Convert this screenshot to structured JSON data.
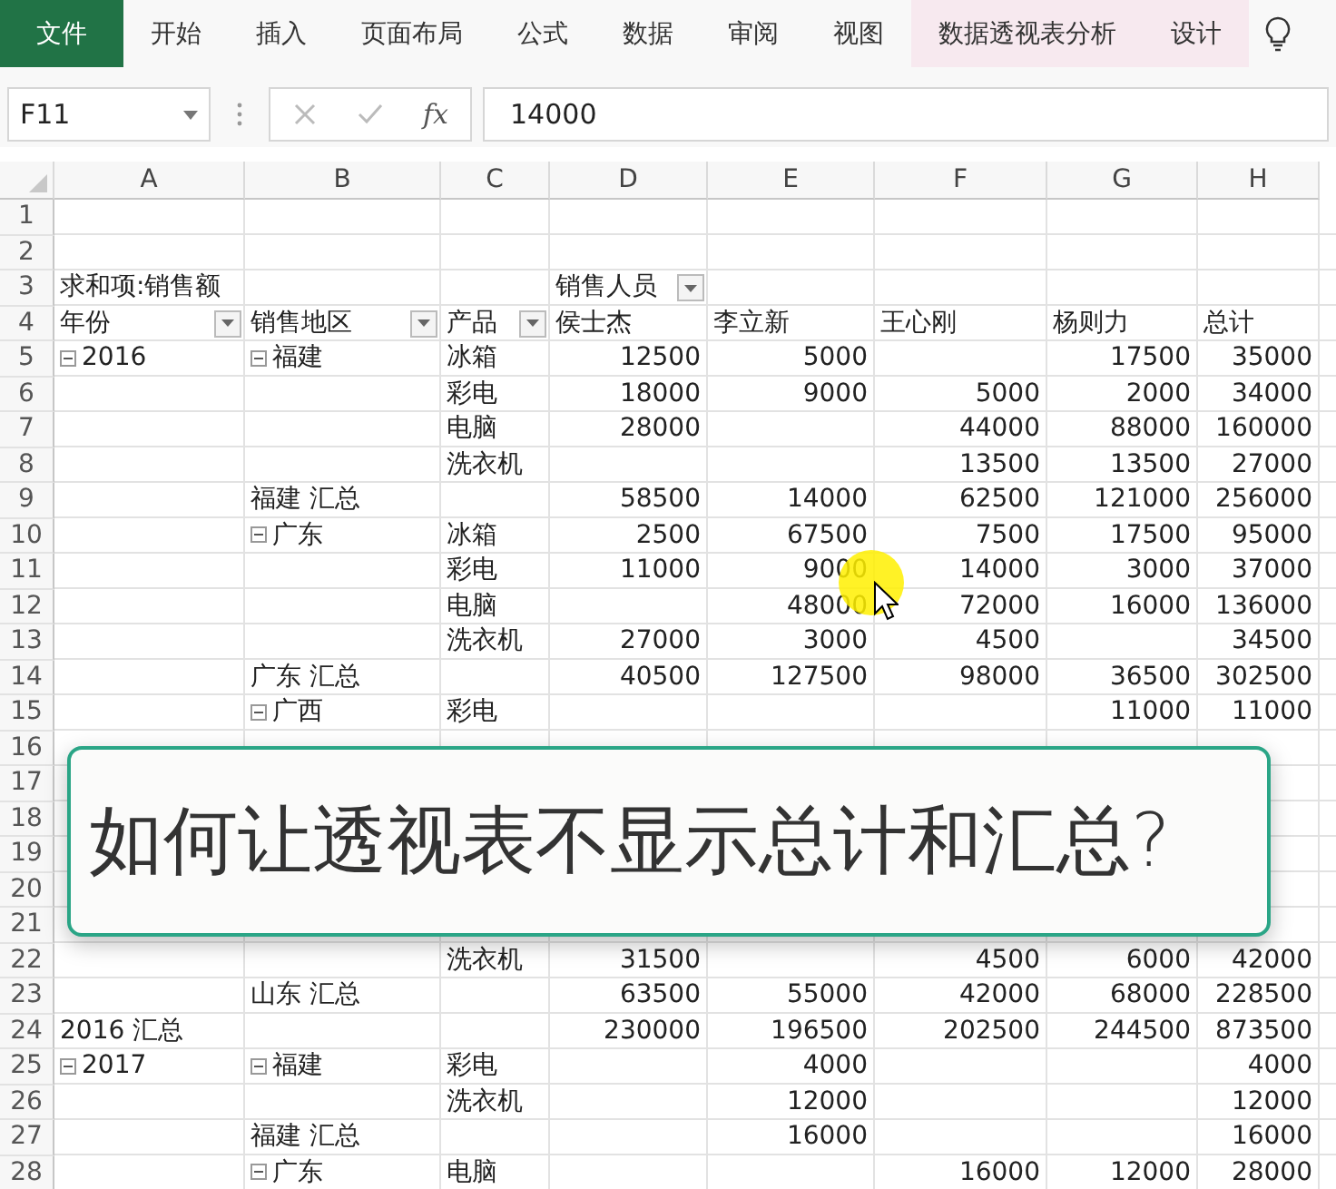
{
  "ribbon": {
    "tabs": [
      {
        "label": "文件",
        "kind": "file"
      },
      {
        "label": "开始",
        "kind": "normal"
      },
      {
        "label": "插入",
        "kind": "normal"
      },
      {
        "label": "页面布局",
        "kind": "normal"
      },
      {
        "label": "公式",
        "kind": "normal"
      },
      {
        "label": "数据",
        "kind": "normal"
      },
      {
        "label": "审阅",
        "kind": "normal"
      },
      {
        "label": "视图",
        "kind": "normal"
      },
      {
        "label": "数据透视表分析",
        "kind": "contextual"
      },
      {
        "label": "设计",
        "kind": "contextual"
      }
    ]
  },
  "formula_bar": {
    "name_box": "F11",
    "function_label": "fx",
    "value": "14000"
  },
  "columns": [
    "A",
    "B",
    "C",
    "D",
    "E",
    "F",
    "G",
    "H"
  ],
  "rows": [
    {
      "n": "1"
    },
    {
      "n": "2"
    },
    {
      "n": "3",
      "labels": {
        "A": {
          "text": "求和项:销售额"
        },
        "D": {
          "text": "销售人员",
          "filter": true
        }
      }
    },
    {
      "n": "4",
      "labels": {
        "A": {
          "text": "年份",
          "filter": true
        },
        "B": {
          "text": "销售地区",
          "filter": true
        },
        "C": {
          "text": "产品",
          "filter": true
        },
        "D": {
          "text": "侯士杰"
        },
        "E": {
          "text": "李立新"
        },
        "F": {
          "text": "王心刚"
        },
        "G": {
          "text": "杨则力"
        },
        "H": {
          "text": "总计"
        }
      }
    },
    {
      "n": "5",
      "labels": {
        "A": {
          "text": "2016",
          "expanded": true
        },
        "B": {
          "text": "福建",
          "expanded": true
        },
        "C": {
          "text": "冰箱"
        }
      },
      "values": {
        "D": "12500",
        "E": "5000",
        "G": "17500",
        "H": "35000"
      }
    },
    {
      "n": "6",
      "labels": {
        "C": {
          "text": "彩电"
        }
      },
      "values": {
        "D": "18000",
        "E": "9000",
        "F": "5000",
        "G": "2000",
        "H": "34000"
      }
    },
    {
      "n": "7",
      "labels": {
        "C": {
          "text": "电脑"
        }
      },
      "values": {
        "D": "28000",
        "F": "44000",
        "G": "88000",
        "H": "160000"
      }
    },
    {
      "n": "8",
      "labels": {
        "C": {
          "text": "洗衣机"
        }
      },
      "values": {
        "F": "13500",
        "G": "13500",
        "H": "27000"
      }
    },
    {
      "n": "9",
      "labels": {
        "B": {
          "text": "福建 汇总"
        }
      },
      "values": {
        "D": "58500",
        "E": "14000",
        "F": "62500",
        "G": "121000",
        "H": "256000"
      }
    },
    {
      "n": "10",
      "labels": {
        "B": {
          "text": "广东",
          "expanded": true
        },
        "C": {
          "text": "冰箱"
        }
      },
      "values": {
        "D": "2500",
        "E": "67500",
        "F": "7500",
        "G": "17500",
        "H": "95000"
      }
    },
    {
      "n": "11",
      "labels": {
        "C": {
          "text": "彩电"
        }
      },
      "values": {
        "D": "11000",
        "E": "9000",
        "F": "14000",
        "G": "3000",
        "H": "37000"
      }
    },
    {
      "n": "12",
      "labels": {
        "C": {
          "text": "电脑"
        }
      },
      "values": {
        "E": "48000",
        "F": "72000",
        "G": "16000",
        "H": "136000"
      }
    },
    {
      "n": "13",
      "labels": {
        "C": {
          "text": "洗衣机"
        }
      },
      "values": {
        "D": "27000",
        "E": "3000",
        "F": "4500",
        "H": "34500"
      }
    },
    {
      "n": "14",
      "labels": {
        "B": {
          "text": "广东 汇总"
        }
      },
      "values": {
        "D": "40500",
        "E": "127500",
        "F": "98000",
        "G": "36500",
        "H": "302500"
      }
    },
    {
      "n": "15",
      "labels": {
        "B": {
          "text": "广西",
          "expanded": true
        },
        "C": {
          "text": "彩电"
        }
      },
      "values": {
        "G": "11000",
        "H": "11000"
      }
    },
    {
      "n": "16"
    },
    {
      "n": "17"
    },
    {
      "n": "18"
    },
    {
      "n": "19"
    },
    {
      "n": "20"
    },
    {
      "n": "21"
    },
    {
      "n": "22",
      "labels": {
        "C": {
          "text": "洗衣机"
        }
      },
      "values": {
        "D": "31500",
        "F": "4500",
        "G": "6000",
        "H": "42000"
      }
    },
    {
      "n": "23",
      "labels": {
        "B": {
          "text": "山东 汇总"
        }
      },
      "values": {
        "D": "63500",
        "E": "55000",
        "F": "42000",
        "G": "68000",
        "H": "228500"
      }
    },
    {
      "n": "24",
      "labels": {
        "A": {
          "text": "2016 汇总"
        }
      },
      "values": {
        "D": "230000",
        "E": "196500",
        "F": "202500",
        "G": "244500",
        "H": "873500"
      }
    },
    {
      "n": "25",
      "labels": {
        "A": {
          "text": "2017",
          "expanded": true
        },
        "B": {
          "text": "福建",
          "expanded": true
        },
        "C": {
          "text": "彩电"
        }
      },
      "values": {
        "E": "4000",
        "H": "4000"
      }
    },
    {
      "n": "26",
      "labels": {
        "C": {
          "text": "洗衣机"
        }
      },
      "values": {
        "E": "12000",
        "H": "12000"
      }
    },
    {
      "n": "27",
      "labels": {
        "B": {
          "text": "福建 汇总"
        }
      },
      "values": {
        "E": "16000",
        "H": "16000"
      }
    },
    {
      "n": "28",
      "labels": {
        "B": {
          "text": "广东",
          "expanded": true
        },
        "C": {
          "text": "电脑"
        }
      },
      "values": {
        "F": "16000",
        "G": "12000",
        "H": "28000"
      }
    }
  ],
  "overlay": {
    "caption": "如何让透视表不显示总计和汇总?"
  }
}
